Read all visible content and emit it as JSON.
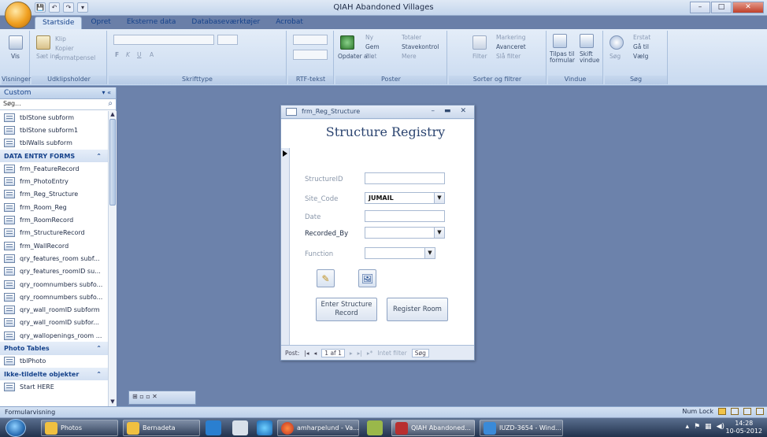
{
  "app": {
    "window_title": "QIAH Abandoned Villages",
    "office_button": "",
    "qat": [
      "💾",
      "↶",
      "↷",
      "▾"
    ],
    "window_controls": [
      "–",
      "□",
      "✕"
    ]
  },
  "ribbon": {
    "tabs": [
      "Startside",
      "Opret",
      "Eksterne data",
      "Databaseværktøjer",
      "Acrobat"
    ],
    "groups": {
      "views": {
        "label": "Visninger",
        "button": "Vis"
      },
      "clipboard": {
        "label": "Udklipsholder",
        "buttons": [
          "Klip",
          "Kopier",
          "Sæt ind",
          "Formatpensel"
        ]
      },
      "font": {
        "label": "Skrifttype",
        "buttons": [
          "F",
          "K",
          "U",
          "A"
        ]
      },
      "rtf": {
        "label": "RTF-tekst"
      },
      "records": {
        "label": "Poster",
        "buttons": [
          "Ny",
          "Gem",
          "Slet",
          "Totaler",
          "Stavekontrol",
          "Mere",
          "Opdater alle"
        ]
      },
      "sort": {
        "label": "Sorter og filtrer",
        "buttons": [
          "Filter",
          "Markering",
          "Avanceret",
          "Slå filter"
        ]
      },
      "window": {
        "label": "Vindue",
        "buttons": [
          "Tilpas til formular",
          "Skift vindue"
        ]
      },
      "find": {
        "label": "Søg",
        "buttons": [
          "Søg",
          "Erstat",
          "Gå til",
          "Vælg"
        ]
      }
    }
  },
  "nav": {
    "header": "Custom",
    "header_ctrl": "▾ «",
    "search_placeholder": "Søg...",
    "items": [
      {
        "type": "item",
        "label": "tblStone subform"
      },
      {
        "type": "item",
        "label": "tblStone subform1"
      },
      {
        "type": "item",
        "label": "tblWalls subform"
      },
      {
        "type": "section",
        "label": "DATA ENTRY FORMS",
        "ctrl": "⌃"
      },
      {
        "type": "item",
        "label": "frm_FeatureRecord"
      },
      {
        "type": "item",
        "label": "frm_PhotoEntry"
      },
      {
        "type": "item",
        "label": "frm_Reg_Structure"
      },
      {
        "type": "item",
        "label": "frm_Room_Reg"
      },
      {
        "type": "item",
        "label": "frm_RoomRecord"
      },
      {
        "type": "item",
        "label": "frm_StructureRecord"
      },
      {
        "type": "item",
        "label": "frm_WallRecord"
      },
      {
        "type": "item",
        "label": "qry_features_room subf..."
      },
      {
        "type": "item",
        "label": "qry_features_roomID su..."
      },
      {
        "type": "item",
        "label": "qry_roomnumbers subfo..."
      },
      {
        "type": "item",
        "label": "qry_roomnumbers subfo..."
      },
      {
        "type": "item",
        "label": "qry_wall_roomID subform"
      },
      {
        "type": "item",
        "label": "qry_wall_roomID subfor..."
      },
      {
        "type": "item",
        "label": "qry_wallopenings_room ..."
      },
      {
        "type": "section",
        "label": "Photo Tables",
        "ctrl": "⌃"
      },
      {
        "type": "item",
        "label": "tblPhoto"
      },
      {
        "type": "section",
        "label": "Ikke-tildelte objekter",
        "ctrl": "⌃"
      },
      {
        "type": "item",
        "label": "Start HERE"
      }
    ]
  },
  "minimized_window": {
    "label": "⊞ ▫ ▫ ✕"
  },
  "form": {
    "window_title": "frm_Reg_Structure",
    "controls": [
      "–",
      "▬",
      "✕"
    ],
    "heading": "Structure Registry",
    "fields": {
      "structure_id": {
        "label": "StructureID",
        "value": ""
      },
      "site_code": {
        "label": "Site_Code",
        "value": "JUMAIL"
      },
      "date": {
        "label": "Date",
        "value": ""
      },
      "recorded_by": {
        "label": "Recorded_By",
        "value": ""
      },
      "function": {
        "label": "Function",
        "value": ""
      }
    },
    "edit_icon": "✎",
    "photo_icon": "🖼",
    "enter_button": "Enter Structure Record",
    "register_button": "Register Room",
    "nav_bar": {
      "post_label": "Post:",
      "first": "|◂",
      "prev": "◂",
      "position": "1 af 1",
      "next": "▸",
      "last": "▸|",
      "new": "▸*",
      "filter": "Intet filter",
      "search": "Søg"
    }
  },
  "status": {
    "left": "Formularvisning",
    "num_lock": "Num Lock"
  },
  "taskbar": {
    "items": [
      "Photos",
      "Bernadeta",
      "amharpelund - Va...",
      "QIAH Abandoned...",
      "IUZD-3654 - Wind..."
    ],
    "time": "14:28",
    "date": "10-05-2012"
  },
  "colors": {
    "accent": "#15428b",
    "workspace": "#6c82ab",
    "taskbar": "#22324d"
  }
}
